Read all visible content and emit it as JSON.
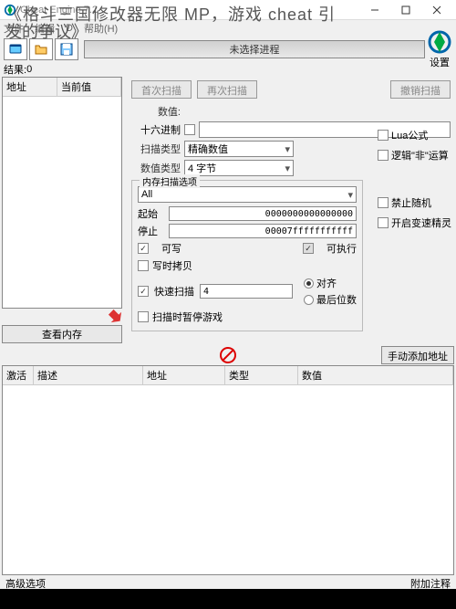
{
  "overlay": {
    "line1": "《格斗三国修改器无限 MP，游戏 cheat 引",
    "line2": "发的争议》"
  },
  "window": {
    "title": "Cheat Engine 7.2"
  },
  "menubar": {
    "file": "文件",
    "edit": "编辑",
    "d": "D",
    "help": "帮助(H)"
  },
  "toolbar": {
    "process_label": "未选择进程",
    "settings": "设置"
  },
  "results": {
    "label": "结果:",
    "count": "0"
  },
  "result_table": {
    "addr": "地址",
    "value": "当前值"
  },
  "view_memory": "查看内存",
  "scan": {
    "first": "首次扫描",
    "next": "再次扫描",
    "undo": "撤销扫描",
    "value_label": "数值:",
    "hex_label": "十六进制",
    "scan_type_label": "扫描类型",
    "scan_type_value": "精确数值",
    "value_type_label": "数值类型",
    "value_type_value": "4 字节",
    "lua_formula": "Lua公式",
    "not_op": "逻辑\"非\"运算"
  },
  "mem_opts": {
    "title": "内存扫描选项",
    "all": "All",
    "start_label": "起始",
    "start_value": "0000000000000000",
    "stop_label": "停止",
    "stop_value": "00007fffffffffff",
    "writable": "可写",
    "executable": "可执行",
    "cow": "写时拷贝",
    "fast_scan": "快速扫描",
    "fast_value": "4",
    "align": "对齐",
    "last_digits": "最后位数",
    "pause": "扫描时暂停游戏",
    "no_random": "禁止随机",
    "speedhack": "开启变速精灵"
  },
  "add_manual": "手动添加地址",
  "addr_list": {
    "active": "激活",
    "desc": "描述",
    "addr": "地址",
    "type": "类型",
    "value": "数值"
  },
  "footer": {
    "adv": "高级选项",
    "comment": "附加注释"
  }
}
